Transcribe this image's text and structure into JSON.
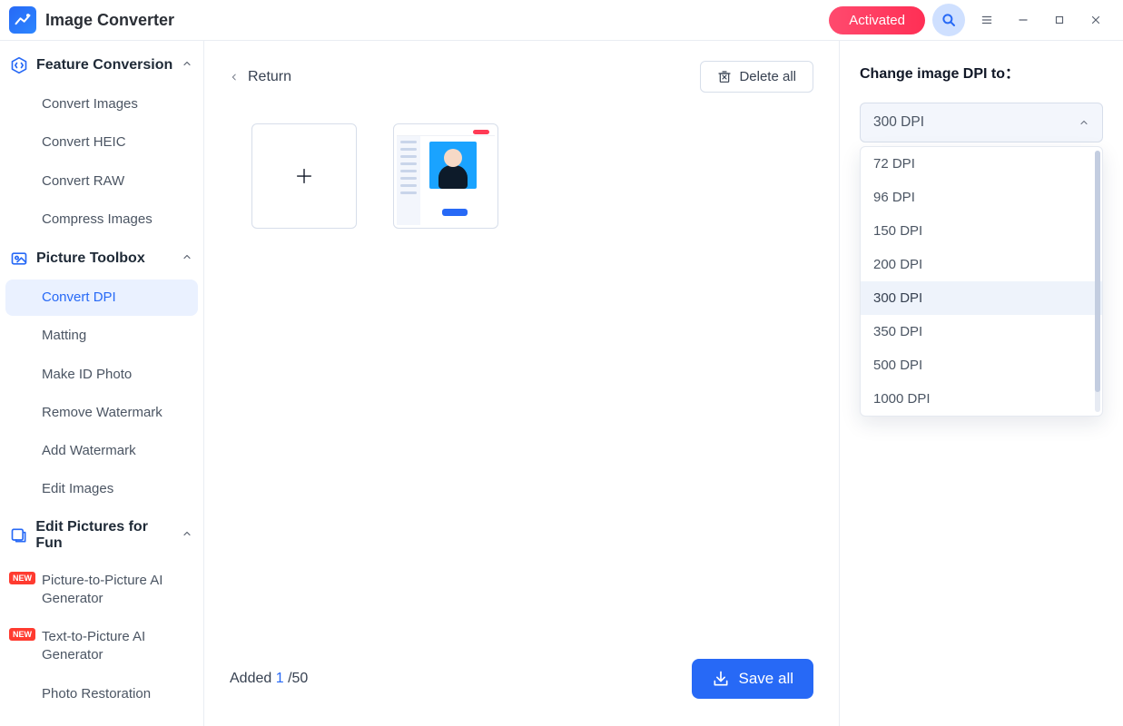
{
  "app": {
    "title": "Image Converter",
    "activated_label": "Activated"
  },
  "sidebar": {
    "sections": [
      {
        "label": "Feature Conversion",
        "items": [
          "Convert Images",
          "Convert HEIC",
          "Convert RAW",
          "Compress Images"
        ]
      },
      {
        "label": "Picture Toolbox",
        "items": [
          "Convert DPI",
          "Matting",
          "Make ID Photo",
          "Remove Watermark",
          "Add Watermark",
          "Edit Images"
        ],
        "active_index": 0
      },
      {
        "label": "Edit Pictures for Fun",
        "items": [
          "Picture-to-Picture AI Generator",
          "Text-to-Picture AI Generator",
          "Photo Restoration"
        ],
        "new_badges": [
          true,
          true,
          false
        ]
      }
    ],
    "new_badge_text": "NEW"
  },
  "center": {
    "return_label": "Return",
    "delete_all_label": "Delete all",
    "added_prefix": "Added ",
    "added_count": "1",
    "added_separator": " /",
    "added_total": "50",
    "save_all_label": "Save all"
  },
  "right": {
    "label": "Change image DPI to：",
    "selected": "300 DPI",
    "options": [
      "72 DPI",
      "96 DPI",
      "150 DPI",
      "200 DPI",
      "300 DPI",
      "350 DPI",
      "500 DPI",
      "1000 DPI"
    ]
  }
}
